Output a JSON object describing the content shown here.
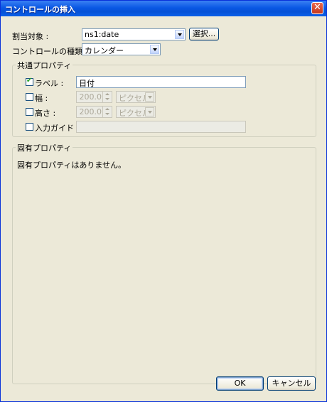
{
  "window": {
    "title": "コントロールの挿入",
    "close_glyph": "✕"
  },
  "assign": {
    "label": "割当対象 :",
    "value": "ns1:date",
    "select_button": "選択..."
  },
  "control_type": {
    "label": "コントロールの種類 :",
    "value": "カレンダー"
  },
  "common": {
    "title": "共通プロパティ",
    "label_row": {
      "label": "ラベル :",
      "checked": true,
      "value": "日付"
    },
    "width_row": {
      "label": "幅 :",
      "checked": false,
      "value": "200.0",
      "unit": "ピクセル"
    },
    "height_row": {
      "label": "高さ :",
      "checked": false,
      "value": "200.0",
      "unit": "ピクセル"
    },
    "guide_row": {
      "label": "入力ガイド :",
      "checked": false,
      "value": ""
    }
  },
  "specific": {
    "title": "固有プロパティ",
    "message": "固有プロパティはありません。"
  },
  "buttons": {
    "ok": "OK",
    "cancel": "キャンセル"
  }
}
